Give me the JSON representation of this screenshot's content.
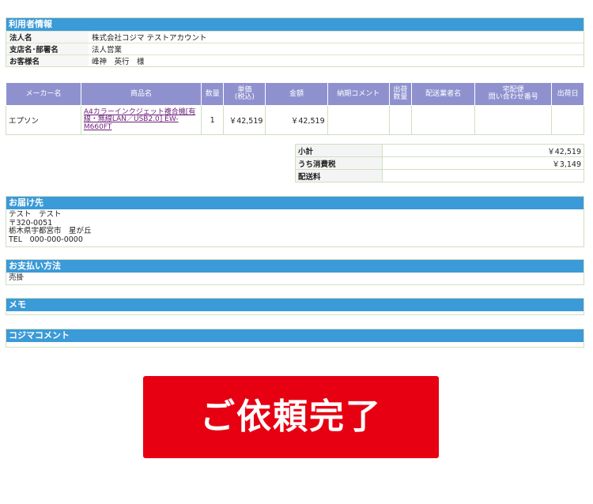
{
  "user_info": {
    "title": "利用者情報",
    "rows": [
      {
        "label": "法人名",
        "value": "株式会社コジマ テストアカウント"
      },
      {
        "label": "支店名･部署名",
        "value": "法人営業"
      },
      {
        "label": "お客様名",
        "value": "峰神　英行　様"
      }
    ]
  },
  "order_table": {
    "headers": [
      "メーカー名",
      "商品名",
      "数量",
      "単価\n(税込)",
      "金額",
      "納期コメント",
      "出荷\n数量",
      "配送業者名",
      "宅配便\n問い合わせ番号",
      "出荷日"
    ],
    "rows": [
      {
        "maker": "エプソン",
        "product": "A4カラーインクジェット複合機[有線・無線LAN／USB2.0] EW-M660FT",
        "quantity": "1",
        "unit_price": "￥42,519",
        "amount": "￥42,519",
        "delivery_comment": "",
        "shipped_qty": "",
        "carrier": "",
        "tracking_no": "",
        "ship_date": ""
      }
    ]
  },
  "totals": [
    {
      "label": "小計",
      "value": "￥42,519"
    },
    {
      "label": "うち消費税",
      "value": "￥3,149"
    },
    {
      "label": "配送料",
      "value": ""
    }
  ],
  "delivery": {
    "title": "お届け先",
    "lines": [
      "テスト　テスト",
      "〒320-0051",
      "栃木県宇都宮市　星が丘",
      "TEL　000-000-0000"
    ]
  },
  "payment": {
    "title": "お支払い方法",
    "value": "売掛"
  },
  "memo": {
    "title": "メモ",
    "value": ""
  },
  "kojima_comment": {
    "title": "コジマコメント",
    "value": ""
  },
  "complete_button": {
    "label": "ご依頼完了"
  },
  "colors": {
    "section_header": "#3b9ad8",
    "table_header": "#8f91cf",
    "cta": "#e60012",
    "link": "#6b1f7a"
  }
}
